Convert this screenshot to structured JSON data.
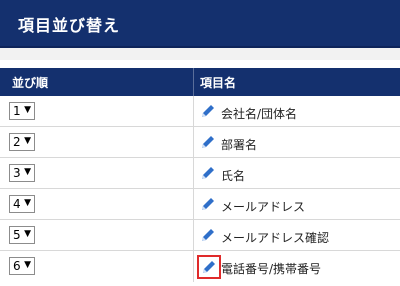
{
  "page": {
    "title": "項目並び替え"
  },
  "table": {
    "headers": {
      "order": "並び順",
      "field_name": "項目名"
    },
    "rows": [
      {
        "order": "1",
        "field": "会社名/団体名"
      },
      {
        "order": "2",
        "field": "部署名"
      },
      {
        "order": "3",
        "field": "氏名"
      },
      {
        "order": "4",
        "field": "メールアドレス"
      },
      {
        "order": "5",
        "field": "メールアドレス確認"
      },
      {
        "order": "6",
        "field": "電話番号/携帯番号"
      }
    ]
  },
  "icons": {
    "edit": "pencil-icon",
    "dropdown": "▼"
  },
  "colors": {
    "header_bg": "#14306e",
    "highlight": "#e02b2b"
  }
}
